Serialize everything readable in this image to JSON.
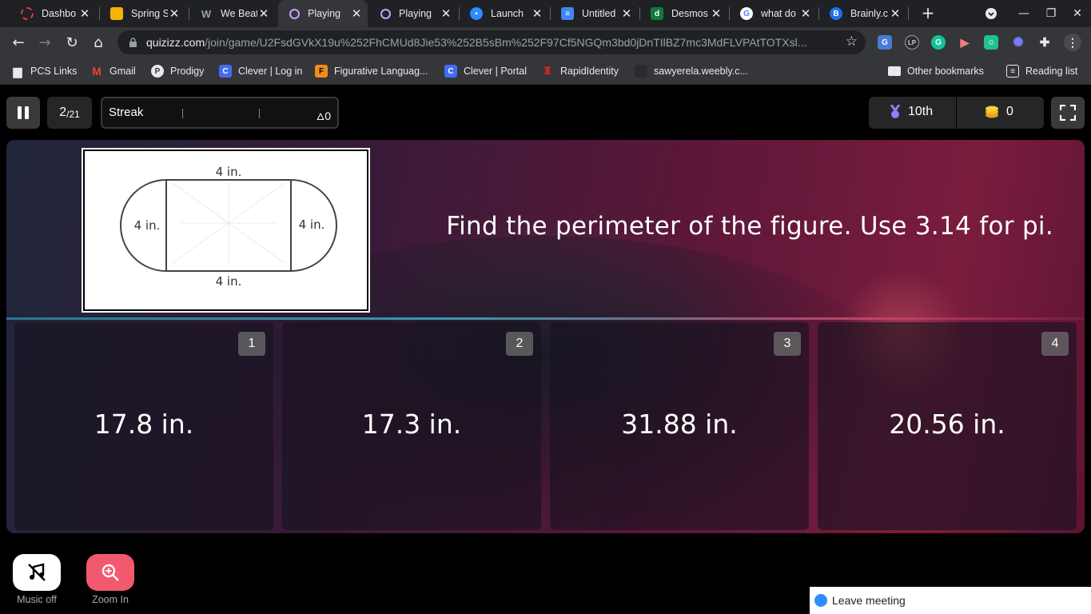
{
  "browser": {
    "tabs": [
      {
        "label": "Dashbo",
        "favicon": "dashboard-icon",
        "color": "#e53935",
        "active": false
      },
      {
        "label": "Spring S",
        "favicon": "slides-icon",
        "color": "#f4b400",
        "active": false
      },
      {
        "label": "We Beat",
        "favicon": "wattpad-icon",
        "color": "#5f6368",
        "active": false
      },
      {
        "label": "Playing",
        "favicon": "quizizz-icon",
        "color": "#8e44ad",
        "active": true
      },
      {
        "label": "Playing",
        "favicon": "quizizz-icon",
        "color": "#8e44ad",
        "active": false
      },
      {
        "label": "Launch",
        "favicon": "zoom-icon",
        "color": "#2d8cff",
        "active": false
      },
      {
        "label": "Untitled",
        "favicon": "docs-icon",
        "color": "#4285f4",
        "active": false
      },
      {
        "label": "Desmos",
        "favicon": "desmos-icon",
        "color": "#127a3d",
        "active": false
      },
      {
        "label": "what do",
        "favicon": "google-icon",
        "color": "#ffffff",
        "active": false
      },
      {
        "label": "Brainly.c",
        "favicon": "brainly-icon",
        "color": "#1a73e8",
        "active": false
      }
    ],
    "url_host": "quizizz.com",
    "url_path": "/join/game/U2FsdGVkX19u%252FhCMUd8Jie53%252B5sBm%252F97Cf5NGQm3bd0jDnTIlBZ7mc3MdFLVPAtTOTXsl...",
    "bookmarks": [
      {
        "label": "PCS Links",
        "icon": "bookmark-icon",
        "color": "#5f6368"
      },
      {
        "label": "Gmail",
        "icon": "gmail-icon",
        "color": "#ea4335"
      },
      {
        "label": "Prodigy",
        "icon": "prodigy-icon",
        "color": "#e8eaed"
      },
      {
        "label": "Clever | Log in",
        "icon": "clever-icon",
        "color": "#436cf2"
      },
      {
        "label": "Figurative Languag...",
        "icon": "figurative-icon",
        "color": "#f48a1c"
      },
      {
        "label": "Clever | Portal",
        "icon": "clever-icon",
        "color": "#436cf2"
      },
      {
        "label": "RapidIdentity",
        "icon": "rapididentity-icon",
        "color": "#c62828"
      },
      {
        "label": "sawyerela.weebly.c...",
        "icon": "weebly-icon",
        "color": "#3a3a3a"
      }
    ],
    "other_bookmarks": "Other bookmarks",
    "reading_list": "Reading list"
  },
  "game": {
    "question_current": "2",
    "question_total": "/21",
    "streak_label": "Streak",
    "streak_count": "0",
    "rank": "10th",
    "coins": "0",
    "question": "Find the perimeter of the figure. Use 3.14 for pi.",
    "figure_labels": {
      "top": "4 in.",
      "bottom": "4 in.",
      "left": "4 in.",
      "right": "4 in."
    },
    "options": [
      {
        "number": "1",
        "text": "17.8 in."
      },
      {
        "number": "2",
        "text": "17.3 in."
      },
      {
        "number": "3",
        "text": "31.88 in."
      },
      {
        "number": "4",
        "text": "20.56 in."
      }
    ],
    "music_label": "Music off",
    "zoom_label": "Zoom In"
  },
  "meeting": {
    "leave_label": "Leave meeting"
  },
  "colors": {
    "zoom_btn": "#f2586e",
    "panel_accent": "#7a1c3e"
  }
}
